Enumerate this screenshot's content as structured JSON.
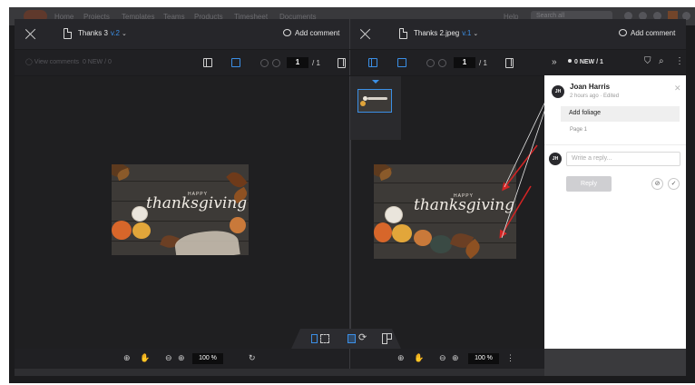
{
  "background_nav": {
    "items": [
      "Home",
      "Projects",
      "Templates",
      "Teams",
      "Products",
      "Timesheet",
      "Documents"
    ],
    "help": "Help",
    "search_placeholder": "Search all"
  },
  "left_viewer": {
    "file_name": "Thanks 3",
    "version": "v.2",
    "add_comment": "Add comment",
    "view_comments": "View comments",
    "new_count": "0 NEW / 0",
    "page_current": "1",
    "page_total": "/ 1",
    "zoom": "100 %"
  },
  "right_viewer": {
    "file_name": "Thanks 2.jpeg",
    "version": "v.1",
    "add_comment": "Add comment",
    "page_current": "1",
    "page_total": "/ 1",
    "zoom": "100 %"
  },
  "image_text": {
    "happy": "HAPPY",
    "thanks": "thanksgiving"
  },
  "comments_panel": {
    "new_filter": "0 NEW / 1",
    "comment": {
      "initials": "JH",
      "author": "Joan Harris",
      "time": "2 hours ago",
      "edited": "Edited",
      "body": "Add foliage",
      "page": "Page 1"
    },
    "reply_initials": "JH",
    "reply_placeholder": "Write a reply...",
    "reply_button": "Reply"
  },
  "colors": {
    "accent": "#3b8fe6",
    "annotation": "#d42424",
    "panel_bg": "#1f1f21"
  }
}
